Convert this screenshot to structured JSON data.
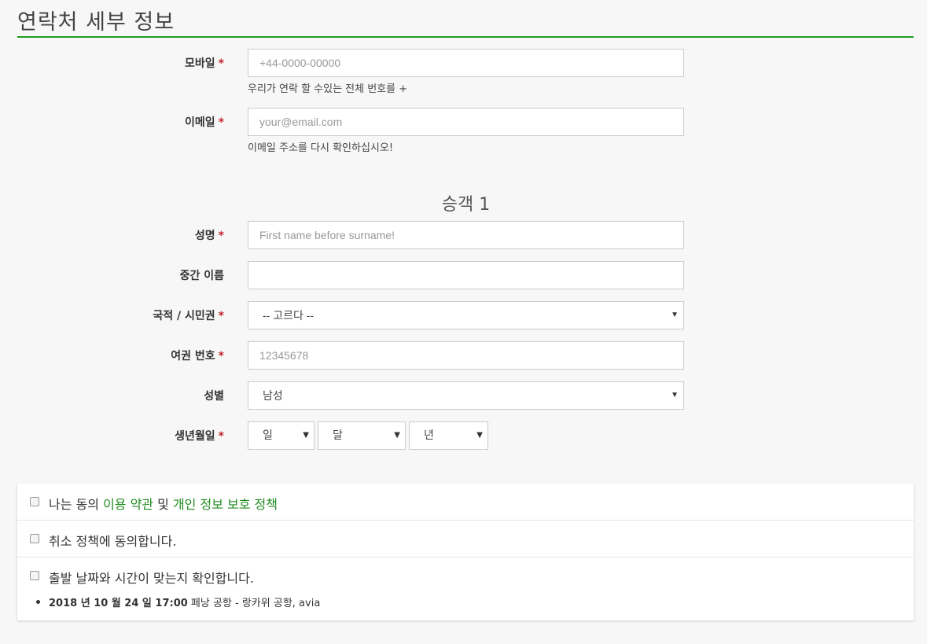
{
  "section_title": "연락처 세부 정보",
  "required_mark": "*",
  "mobile": {
    "label": "모바일",
    "placeholder": "+44-0000-00000",
    "help": "우리가 연락 할 수있는 전체 번호를 +"
  },
  "email": {
    "label": "이메일",
    "placeholder": "your@email.com",
    "help": "이메일 주소를 다시 확인하십시오!"
  },
  "passenger_heading": "승객 1",
  "name": {
    "label": "성명",
    "placeholder": "First name before surname!"
  },
  "middle_name": {
    "label": "중간 이름",
    "value": ""
  },
  "nationality": {
    "label": "국적 / 시민권",
    "value": "-- 고르다 --"
  },
  "passport": {
    "label": "여권 번호",
    "placeholder": "12345678"
  },
  "gender": {
    "label": "성별",
    "value": "남성"
  },
  "dob": {
    "label": "생년월일",
    "day": "일",
    "month": "달",
    "year": "년"
  },
  "agreements": {
    "terms_prefix": "나는 동의",
    "terms_link": "이용 약관",
    "terms_and": "및",
    "privacy_link": "개인 정보 보호 정책",
    "cancel_policy": "취소 정책에 동의합니다.",
    "confirm_time": "출발 날짜와 시간이 맞는지 확인합니다.",
    "flight_datetime": "2018 년 10 월 24 일 17:00",
    "flight_route": "페낭 공항 - 랑카위 공항, avia"
  },
  "colors": {
    "accent": "#1e9a1e",
    "required": "#c0262d",
    "link": "#1e8a1e"
  }
}
